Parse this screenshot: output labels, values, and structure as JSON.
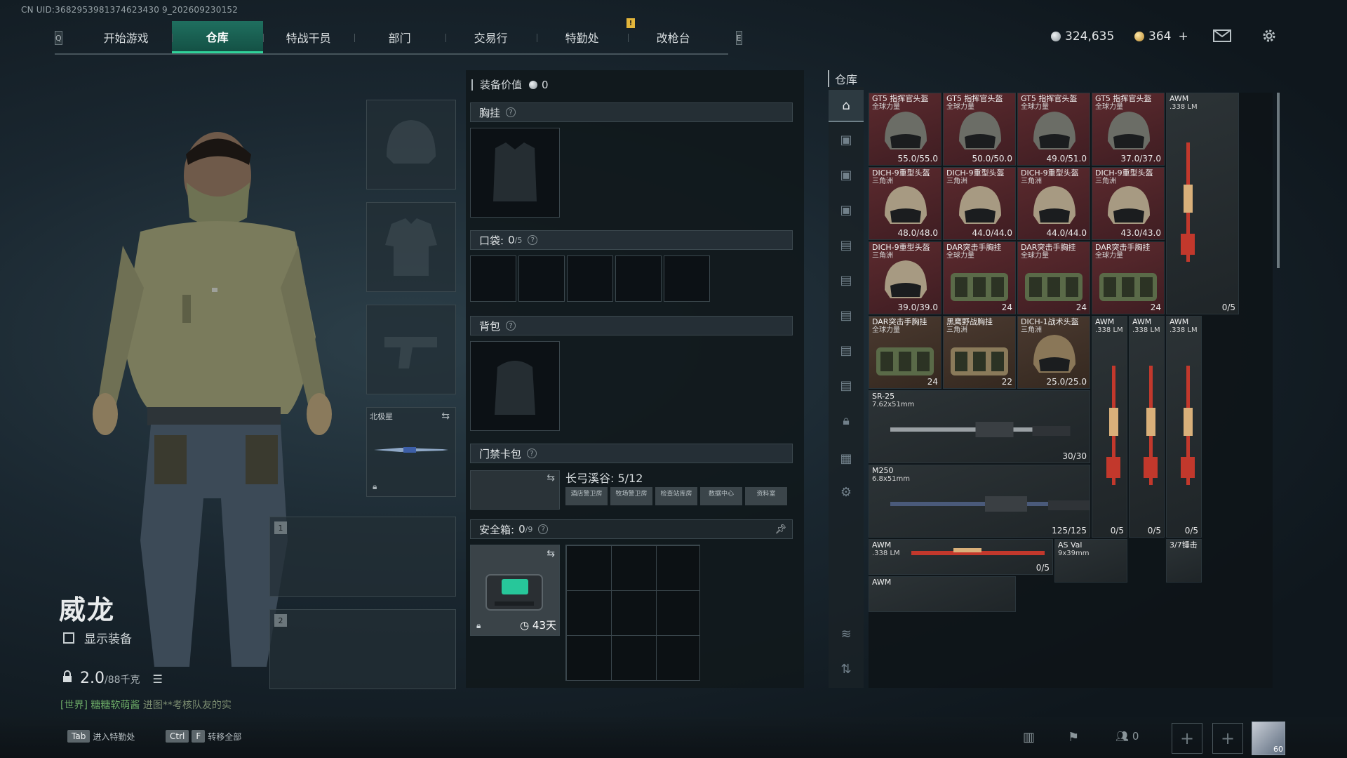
{
  "header": {
    "uid": "CN UID:3682953981374623430 9_202609230152",
    "nav_key_left": "Q",
    "nav_key_right": "E",
    "tabs": [
      {
        "label": "开始游戏",
        "active": false
      },
      {
        "label": "仓库",
        "active": true
      },
      {
        "label": "特战干员",
        "active": false
      },
      {
        "label": "部门",
        "active": false
      },
      {
        "label": "交易行",
        "active": false
      },
      {
        "label": "特勤处",
        "active": false
      },
      {
        "label": "改枪台",
        "active": false
      }
    ],
    "alert": "!",
    "silver": "324,635",
    "gold": "364",
    "gold_plus": "+",
    "icons": [
      "mail-icon",
      "gear-icon"
    ]
  },
  "character": {
    "name": "威龙",
    "show_equipment": "显示装备",
    "weight": "2.0",
    "weight_max": "/88千克",
    "chat_prefix": "[世界]",
    "chat_user": "糖糖软萌酱",
    "chat_text": "进图**考核队友的实"
  },
  "slots": {
    "secondary_label": "北极星",
    "weapon_slot_1": "1",
    "weapon_slot_2": "2"
  },
  "loadout": {
    "value_label": "装备价值",
    "value": "0",
    "chest_label": "胸挂",
    "pocket_label": "口袋:",
    "pocket_count": "0",
    "pocket_max": "/5",
    "backpack_label": "背包",
    "keycard_label": "门禁卡包",
    "keycard_title": "长弓溪谷: 5/12",
    "keycard_tabs": [
      "酒店警卫房",
      "牧场警卫房",
      "检查站库房",
      "数据中心",
      "资料室"
    ],
    "safe_label": "安全箱:",
    "safe_count": "0",
    "safe_max": "/9",
    "safe_days": "43天",
    "help": "?"
  },
  "warehouse": {
    "title": "仓库",
    "items": [
      {
        "name": "GT5 指挥官头盔",
        "sub": "全球力量",
        "count": "55.0/55.0",
        "bg": "red"
      },
      {
        "name": "GT5 指挥官头盔",
        "sub": "全球力量",
        "count": "50.0/50.0",
        "bg": "red"
      },
      {
        "name": "GT5 指挥官头盔",
        "sub": "全球力量",
        "count": "49.0/51.0",
        "bg": "red"
      },
      {
        "name": "GT5 指挥官头盔",
        "sub": "全球力量",
        "count": "37.0/37.0",
        "bg": "red"
      },
      {
        "name": "DICH-9重型头盔",
        "sub": "三角洲",
        "count": "48.0/48.0",
        "bg": "red"
      },
      {
        "name": "DICH-9重型头盔",
        "sub": "三角洲",
        "count": "44.0/44.0",
        "bg": "red"
      },
      {
        "name": "DICH-9重型头盔",
        "sub": "三角洲",
        "count": "44.0/44.0",
        "bg": "red"
      },
      {
        "name": "DICH-9重型头盔",
        "sub": "三角洲",
        "count": "43.0/43.0",
        "bg": "red"
      },
      {
        "name": "DICH-9重型头盔",
        "sub": "三角洲",
        "count": "39.0/39.0",
        "bg": "red"
      },
      {
        "name": "DAR突击手胸挂",
        "sub": "全球力量",
        "count": "24",
        "bg": "red"
      },
      {
        "name": "DAR突击手胸挂",
        "sub": "全球力量",
        "count": "24",
        "bg": "red"
      },
      {
        "name": "DAR突击手胸挂",
        "sub": "全球力量",
        "count": "24",
        "bg": "red"
      },
      {
        "name": "DAR突击手胸挂",
        "sub": "全球力量",
        "count": "24",
        "bg": "brown"
      },
      {
        "name": "黑鹰野战胸挂",
        "sub": "三角洲",
        "count": "22",
        "bg": "brown"
      },
      {
        "name": "DICH-1战术头盔",
        "sub": "三角洲",
        "count": "25.0/25.0",
        "bg": "brown"
      },
      {
        "name": "AWM",
        "sub": ".338 LM",
        "count": "0/5",
        "bg": "dark"
      },
      {
        "name": "AWM",
        "sub": ".338 LM",
        "count": "0/5",
        "bg": "dark"
      },
      {
        "name": "AWM",
        "sub": ".338 LM",
        "count": "0/5",
        "bg": "dark"
      },
      {
        "name": "AWM",
        "sub": ".338 LM",
        "count": "0/5",
        "bg": "dark"
      },
      {
        "name": "SR-25",
        "sub": "7.62x51mm",
        "count": "30/30",
        "bg": "dark"
      },
      {
        "name": "M250",
        "sub": "6.8x51mm",
        "count": "125/125",
        "bg": "dark"
      },
      {
        "name": "AWM",
        "sub": ".338 LM",
        "count": "0/5",
        "bg": "dark"
      },
      {
        "name": "AS Val",
        "sub": "9x39mm",
        "count": "",
        "bg": "dark"
      },
      {
        "name": "3/7锤击",
        "sub": "",
        "count": "",
        "bg": "dark"
      },
      {
        "name": "AWM",
        "sub": "",
        "count": "",
        "bg": "dark"
      }
    ]
  },
  "bottom": {
    "tab_key": "Tab",
    "tab_label": "进入特勤处",
    "ctrl_key": "Ctrl",
    "f_key": "F",
    "ctrl_label": "转移全部",
    "friends": "0",
    "avatar_level": "60"
  }
}
